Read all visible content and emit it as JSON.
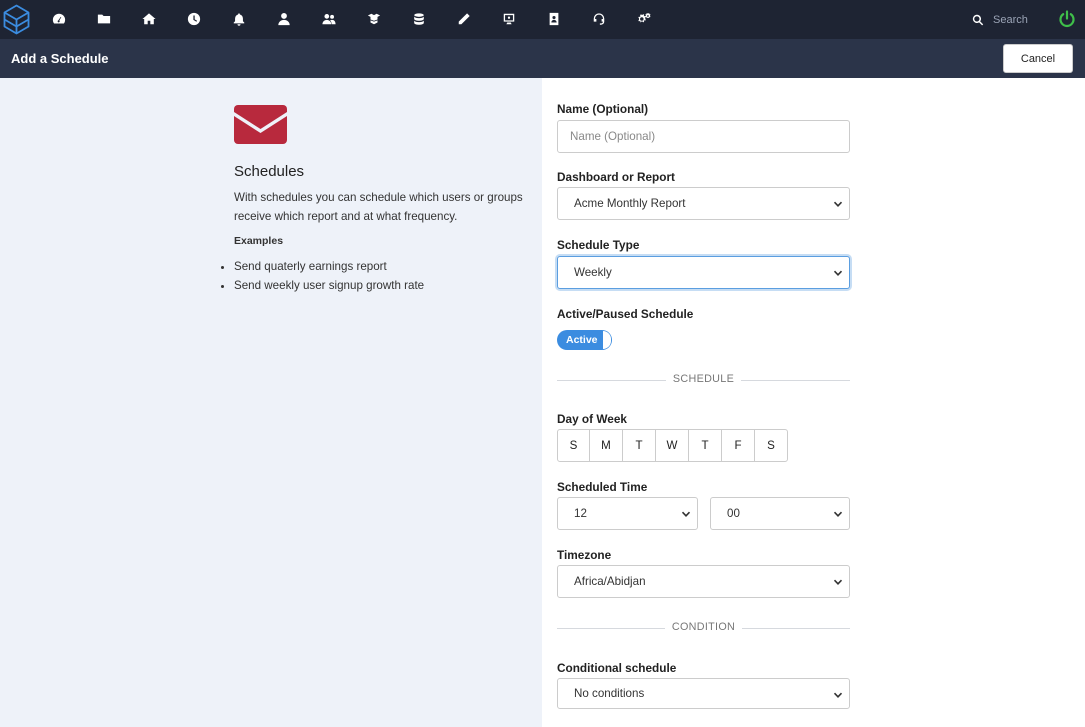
{
  "search": {
    "placeholder": "Search"
  },
  "nav_icons": [
    "logo-icon",
    "dashboard-icon",
    "folder-icon",
    "home-icon",
    "clock-icon",
    "bell-icon",
    "user-icon",
    "users-icon",
    "boxes-icon",
    "database-icon",
    "pencil-icon",
    "monitor-icon",
    "address-book-icon",
    "headset-icon",
    "cogs-icon",
    "search-icon",
    "power-icon"
  ],
  "header": {
    "title": "Add a Schedule",
    "cancel_label": "Cancel"
  },
  "info": {
    "title": "Schedules",
    "description": "With schedules you can schedule which users or groups receive which report and at what frequency.",
    "examples_label": "Examples",
    "examples": [
      "Send quaterly earnings report",
      "Send weekly user signup growth rate"
    ]
  },
  "form": {
    "name": {
      "label": "Name (Optional)",
      "placeholder": "Name (Optional)",
      "value": ""
    },
    "dashboard": {
      "label": "Dashboard or Report",
      "value": "Acme Monthly Report"
    },
    "schedule_type": {
      "label": "Schedule Type",
      "value": "Weekly"
    },
    "active": {
      "label": "Active/Paused Schedule",
      "toggle_label": "Active",
      "on": true
    },
    "schedule_divider": "SCHEDULE",
    "day_of_week": {
      "label": "Day of Week",
      "days": [
        "S",
        "M",
        "T",
        "W",
        "T",
        "F",
        "S"
      ]
    },
    "scheduled_time": {
      "label": "Scheduled Time",
      "hour": "12",
      "minute": "00"
    },
    "timezone": {
      "label": "Timezone",
      "value": "Africa/Abidjan"
    },
    "condition_divider": "CONDITION",
    "conditional": {
      "label": "Conditional schedule",
      "value": "No conditions"
    }
  },
  "colors": {
    "nav_bg": "#1e2433",
    "subheader_bg": "#2b3449",
    "left_bg": "#eef2f9",
    "accent": "#3b8ce0",
    "envelope": "#b8293d",
    "power": "#3fbf4a"
  }
}
